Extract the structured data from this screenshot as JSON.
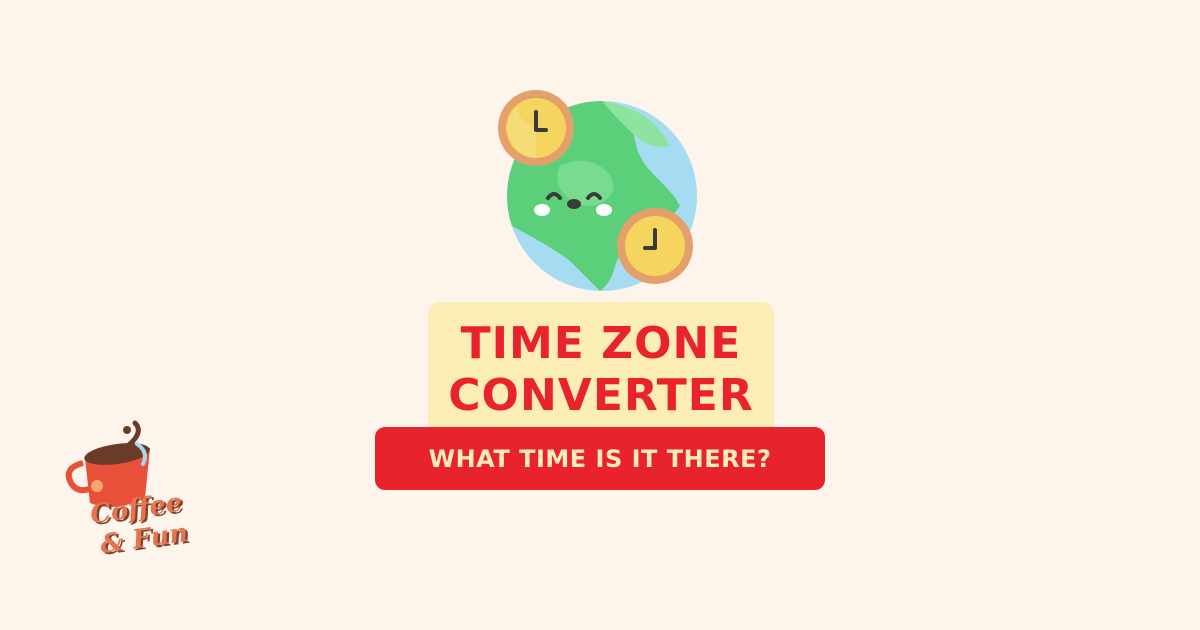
{
  "title": {
    "line1": "TIME ZONE",
    "line2": "CONVERTER"
  },
  "subtitle": "WHAT TIME IS IT THERE?",
  "logo": {
    "line1": "Coffee",
    "line2": "& Fun"
  },
  "colors": {
    "background": "#fdf4ec",
    "accent_red": "#e8232c",
    "title_bg": "#fcecb5",
    "globe_green": "#5bcf7a",
    "globe_blue": "#a6dcf2",
    "clock_gold": "#f5d55e",
    "clock_rim": "#e3a06a"
  },
  "icons": [
    "globe-icon",
    "clock-icon",
    "coffee-cup-logo"
  ]
}
